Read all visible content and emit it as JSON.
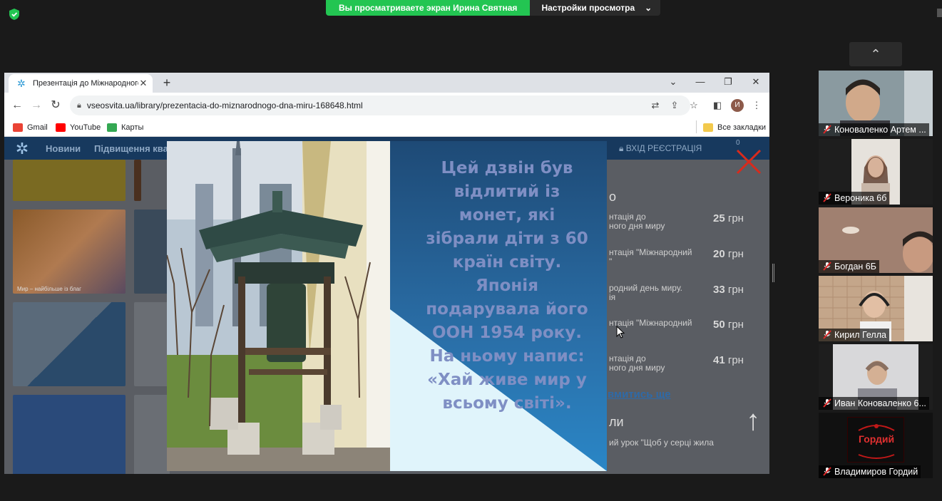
{
  "zoom": {
    "share_banner": "Вы просматриваете экран Ирина Святная",
    "view_settings": "Настройки просмотра"
  },
  "browser": {
    "tab_title": "Презентація до Міжнародного",
    "url": "vseosvita.ua/library/prezentacia-do-miznarodnogo-dna-miru-168648.html",
    "avatar_letter": "И",
    "bookmarks": [
      {
        "label": "Gmail",
        "color": "#ea4335"
      },
      {
        "label": "YouTube",
        "color": "#ff0000"
      },
      {
        "label": "Карты",
        "color": "#34a853"
      }
    ],
    "all_bookmarks": "Все закладки"
  },
  "site": {
    "nav": [
      "Новини",
      "Підвищення ква"
    ],
    "login": "ВХІД   РЕЄСТРАЦІЯ",
    "cart_count": "0",
    "thumb_caption": "Мир – найбільше із благ",
    "section_title_tail": "о",
    "section_title_tail2": "ли",
    "items": [
      {
        "title": "нтація до\nного дня миру",
        "price": "25",
        "currency": "грн"
      },
      {
        "title": "нтація \"Міжнародний\n\"",
        "price": "20",
        "currency": "грн"
      },
      {
        "title": "родний день миру.\nія",
        "price": "33",
        "currency": "грн"
      },
      {
        "title": "нтація \"Міжнародний",
        "price": "50",
        "currency": "грн"
      },
      {
        "title": "нтація до\nного дня миру",
        "price": "41",
        "currency": "грн"
      }
    ],
    "more_link": "вмитись ще",
    "lesson_snippet": "ий урок \"Щоб у серці жила"
  },
  "slide": {
    "text": "Цей дзвін був відлитий із монет, які зібрали діти з 60 країн світу. Японія подарувала його ООН 1954 року. На ньому напис: «Хай живе мир у всьому світі»."
  },
  "participants": [
    {
      "name": "Коноваленко Артем ...",
      "bg": "#7a8a8f"
    },
    {
      "name": "Вероника 6б",
      "bg": "#1e1e1e"
    },
    {
      "name": "Богдан 6Б",
      "bg": "#8a7060"
    },
    {
      "name": "Кирил Гелла",
      "bg": "#b08a70"
    },
    {
      "name": "Иван Коноваленко 6...",
      "bg": "#1e1e1e"
    },
    {
      "name": "Владимиров Гордий",
      "bg": "#111111",
      "logo_text": "Гордий"
    }
  ]
}
